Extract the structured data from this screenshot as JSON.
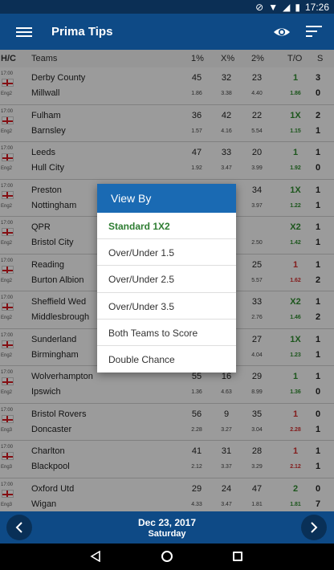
{
  "status_bar": {
    "time": "17:26"
  },
  "app_bar": {
    "title": "Prima Tips"
  },
  "columns": {
    "hc": "H/C",
    "teams": "Teams",
    "p1": "1%",
    "px": "X%",
    "p2": "2%",
    "to": "T/O",
    "s": "S"
  },
  "matches": [
    {
      "time": "17:00",
      "league": "Eng2",
      "home": "Derby County",
      "away": "Millwall",
      "p1": "45",
      "px": "32",
      "p2": "23",
      "o1": "1.86",
      "ox": "3.38",
      "o2": "4.40",
      "pick": "1",
      "pick_odd": "1.86",
      "s1": "3",
      "s2": "0"
    },
    {
      "time": "17:00",
      "league": "Eng2",
      "home": "Fulham",
      "away": "Barnsley",
      "p1": "36",
      "px": "42",
      "p2": "22",
      "o1": "1.57",
      "ox": "4.16",
      "o2": "5.54",
      "pick": "1X",
      "pick_odd": "1.15",
      "s1": "2",
      "s2": "1"
    },
    {
      "time": "17:00",
      "league": "Eng2",
      "home": "Leeds",
      "away": "Hull City",
      "p1": "47",
      "px": "33",
      "p2": "20",
      "o1": "1.92",
      "ox": "3.47",
      "o2": "3.99",
      "pick": "1",
      "pick_odd": "1.92",
      "s1": "1",
      "s2": "0"
    },
    {
      "time": "17:00",
      "league": "Eng2",
      "home": "Preston",
      "away": "Nottingham",
      "p1": "",
      "px": "",
      "p2": "34",
      "o1": "",
      "ox": "",
      "o2": "3.97",
      "pick": "1X",
      "pick_odd": "1.22",
      "s1": "1",
      "s2": "1"
    },
    {
      "time": "17:00",
      "league": "Eng2",
      "home": "QPR",
      "away": "Bristol City",
      "p1": "",
      "px": "",
      "p2": "",
      "o1": "",
      "ox": "",
      "o2": "2.50",
      "pick": "X2",
      "pick_odd": "1.42",
      "s1": "1",
      "s2": "1"
    },
    {
      "time": "17:00",
      "league": "Eng2",
      "home": "Reading",
      "away": "Burton Albion",
      "p1": "",
      "px": "",
      "p2": "25",
      "o1": "",
      "ox": "",
      "o2": "5.57",
      "pick": "1",
      "pick_odd": "1.62",
      "s1": "1",
      "s2": "2"
    },
    {
      "time": "17:00",
      "league": "Eng2",
      "home": "Sheffield Wed",
      "away": "Middlesbrough",
      "p1": "",
      "px": "",
      "p2": "33",
      "o1": "",
      "ox": "",
      "o2": "2.76",
      "pick": "X2",
      "pick_odd": "1.46",
      "s1": "1",
      "s2": "2"
    },
    {
      "time": "17:00",
      "league": "Eng2",
      "home": "Sunderland",
      "away": "Birmingham",
      "p1": "",
      "px": "",
      "p2": "27",
      "o1": "",
      "ox": "",
      "o2": "4.04",
      "pick": "1X",
      "pick_odd": "1.23",
      "s1": "1",
      "s2": "1"
    },
    {
      "time": "17:00",
      "league": "Eng2",
      "home": "Wolverhampton",
      "away": "Ipswich",
      "p1": "55",
      "px": "16",
      "p2": "29",
      "o1": "1.36",
      "ox": "4.63",
      "o2": "8.99",
      "pick": "1",
      "pick_odd": "1.36",
      "s1": "1",
      "s2": "0"
    },
    {
      "time": "17:00",
      "league": "Eng3",
      "home": "Bristol Rovers",
      "away": "Doncaster",
      "p1": "56",
      "px": "9",
      "p2": "35",
      "o1": "2.28",
      "ox": "3.27",
      "o2": "3.04",
      "pick": "1",
      "pick_odd": "2.28",
      "s1": "0",
      "s2": "1"
    },
    {
      "time": "17:00",
      "league": "Eng3",
      "home": "Charlton",
      "away": "Blackpool",
      "p1": "41",
      "px": "31",
      "p2": "28",
      "o1": "2.12",
      "ox": "3.37",
      "o2": "3.29",
      "pick": "1",
      "pick_odd": "2.12",
      "s1": "1",
      "s2": "1"
    },
    {
      "time": "17:00",
      "league": "Eng3",
      "home": "Oxford Utd",
      "away": "Wigan",
      "p1": "29",
      "px": "24",
      "p2": "47",
      "o1": "4.33",
      "ox": "3.47",
      "o2": "1.81",
      "pick": "2",
      "pick_odd": "1.81",
      "s1": "0",
      "s2": "7"
    }
  ],
  "pick_colors": [
    "green",
    "green",
    "green",
    "green",
    "green",
    "red",
    "green",
    "green",
    "green",
    "red",
    "red",
    "green"
  ],
  "dialog": {
    "title": "View By",
    "options": [
      "Standard 1X2",
      "Over/Under 1.5",
      "Over/Under 2.5",
      "Over/Under 3.5",
      "Both Teams to Score",
      "Double Chance"
    ]
  },
  "footer": {
    "date": "Dec 23, 2017",
    "day": "Saturday"
  },
  "colors": {
    "primary": "#0e4a86",
    "accent": "#1a6ab3",
    "win": "#2e8b2e",
    "loss": "#d32f2f"
  }
}
